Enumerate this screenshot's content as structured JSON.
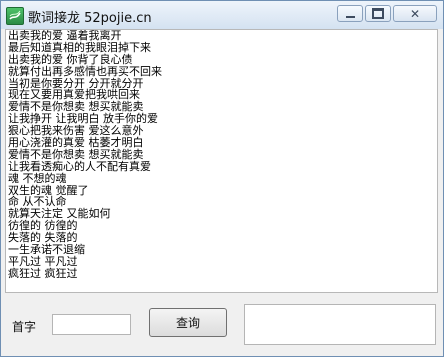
{
  "window": {
    "title": "歌词接龙  52pojie.cn"
  },
  "lyrics": [
    "出卖我的爱 逼着我离开",
    "最后知道真相的我眼泪掉下来",
    "出卖我的爱 你背了良心债",
    "就算付出再多感情也再买不回来",
    "当初是你要分开 分开就分开",
    "现在又要用真爱把我哄回来",
    "爱情不是你想卖 想买就能卖",
    "让我挣开 让我明白 放手你的爱",
    "狠心把我来伤害 爱这么意外",
    "用心浇灌的真爱 枯萎才明白",
    "爱情不是你想卖 想买就能卖",
    "让我看透痴心的人不配有真爱",
    "魂 不想的魂",
    "双生的魂 觉醒了",
    "命 从不认命",
    "就算天注定 又能如何",
    "彷徨的 彷徨的",
    "失落的 失落的",
    "一生承诺不退缩",
    "平凡过 平凡过",
    "疯狂过 疯狂过"
  ],
  "form": {
    "first_char_label": "首字",
    "first_char_value": "",
    "query_button_label": "查询",
    "result_value": ""
  },
  "icons": {
    "app": "app-icon",
    "minimize": "minimize-icon",
    "maximize": "maximize-icon",
    "close": "close-icon"
  }
}
